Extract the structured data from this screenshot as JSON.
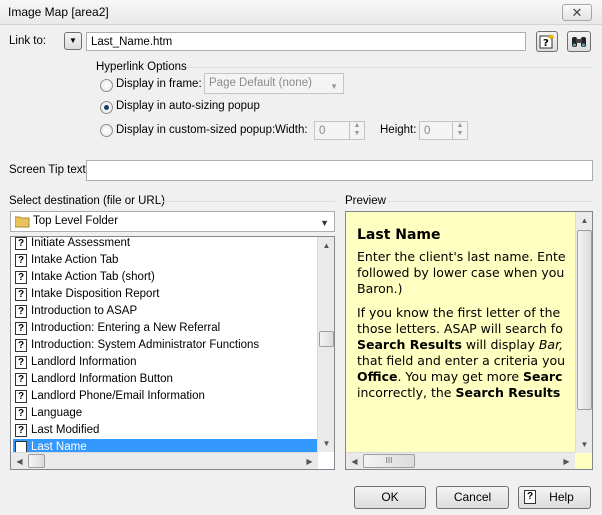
{
  "window": {
    "title": "Image Map [area2]",
    "close_glyph": "✕"
  },
  "link_to": {
    "label": "Link to:",
    "value": "Last_Name.htm"
  },
  "hyperlink_options": {
    "legend": "Hyperlink Options",
    "frame_label": "Display in frame:",
    "frame_select": "Page Default (none)",
    "auto_popup_label": "Display in auto-sizing popup",
    "custom_popup_label": "Display in custom-sized popup:",
    "width_label": "Width:",
    "width_value": "0",
    "height_label": "Height:",
    "height_value": "0",
    "selected": "auto-sizing"
  },
  "screen_tip": {
    "label": "Screen Tip text:",
    "value": ""
  },
  "destination": {
    "label": "Select destination (file or URL)",
    "folder": "Top Level Folder",
    "items": [
      "Initiate Assessment",
      "Intake Action Tab",
      "Intake Action Tab (short)",
      "Intake Disposition Report",
      "Introduction to ASAP",
      "Introduction: Entering a New Referral",
      "Introduction: System Administrator Functions",
      "Landlord Information",
      "Landlord Information Button",
      "Landlord Phone/Email Information",
      "Language",
      "Last Modified",
      "Last Name"
    ],
    "selected_item": "Last Name"
  },
  "preview": {
    "label": "Preview",
    "heading": "Last Name",
    "p1_line1": "Enter the client's last name. Ente",
    "p1_line2": "followed by lower case when you",
    "p1_line3": "Baron.)",
    "p2_line1": "If you know the first letter of the",
    "p2_line2": "those letters. ASAP will search fo",
    "p2_l3_b": "Search Results",
    "p2_l3_t": " will display ",
    "p2_l3_i": "Bar,",
    "p2_line4": "that field and enter a criteria you",
    "p2_l5_b1": "Office",
    "p2_l5_t": ". You may get more ",
    "p2_l5_b2": "Searc",
    "p2_l6_t": "incorrectly, the ",
    "p2_l6_b": "Search Results"
  },
  "buttons": {
    "ok": "OK",
    "cancel": "Cancel",
    "help": "Help"
  },
  "scroll": {
    "grip": "III"
  }
}
